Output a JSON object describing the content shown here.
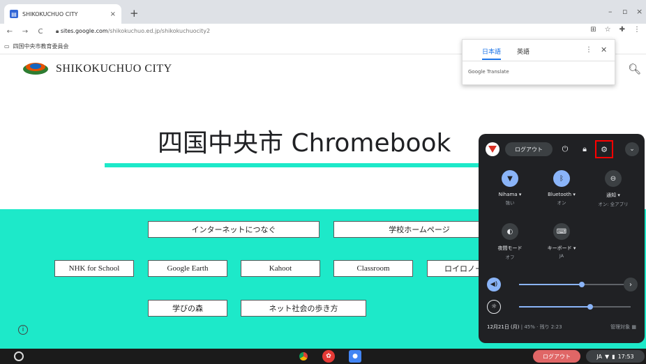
{
  "browser": {
    "tab_title": "SHIKOKUCHUO CITY",
    "tab_close": "×",
    "new_tab": "+",
    "url_host": "sites.google.com",
    "url_path": "/shikokuchuo.ed.jp/shikokuchuocity2",
    "bookmark_label": "四国中央市教育委員会",
    "window_min": "–",
    "window_max": "▫",
    "window_close": "×"
  },
  "translate_popup": {
    "tab_japanese": "日本語",
    "tab_english": "英語",
    "brand": "Google Translate"
  },
  "site": {
    "name": "SHIKOKUCHUO CITY",
    "hero_title": "四国中央市 Chromebook"
  },
  "links": {
    "internet": "インターネットにつなぐ",
    "school_home": "学校ホームページ",
    "nhk": "NHK for School",
    "google_earth": "Google Earth",
    "kahoot": "Kahoot",
    "classroom": "Classroom",
    "roilo": "ロイロノート",
    "manabi": "学びの森",
    "net_society": "ネット社会の歩き方"
  },
  "quick_settings": {
    "logout": "ログアウト",
    "features": [
      {
        "label": "Nihama ▾",
        "sub": "強い"
      },
      {
        "label": "Bluetooth ▾",
        "sub": "オン"
      },
      {
        "label": "通知 ▾",
        "sub": "オン: 全アプリ"
      },
      {
        "label": "夜間モード",
        "sub": "オフ"
      },
      {
        "label": "キーボード ▾",
        "sub": "JA"
      }
    ],
    "volume_level": 0.56,
    "brightness_level": 0.64,
    "date": "12月21日 (月)",
    "battery": "45% · 残り 2:23",
    "managed": "管理対象"
  },
  "shelf": {
    "logout": "ログアウト",
    "ime": "JA",
    "time": "17:53"
  }
}
